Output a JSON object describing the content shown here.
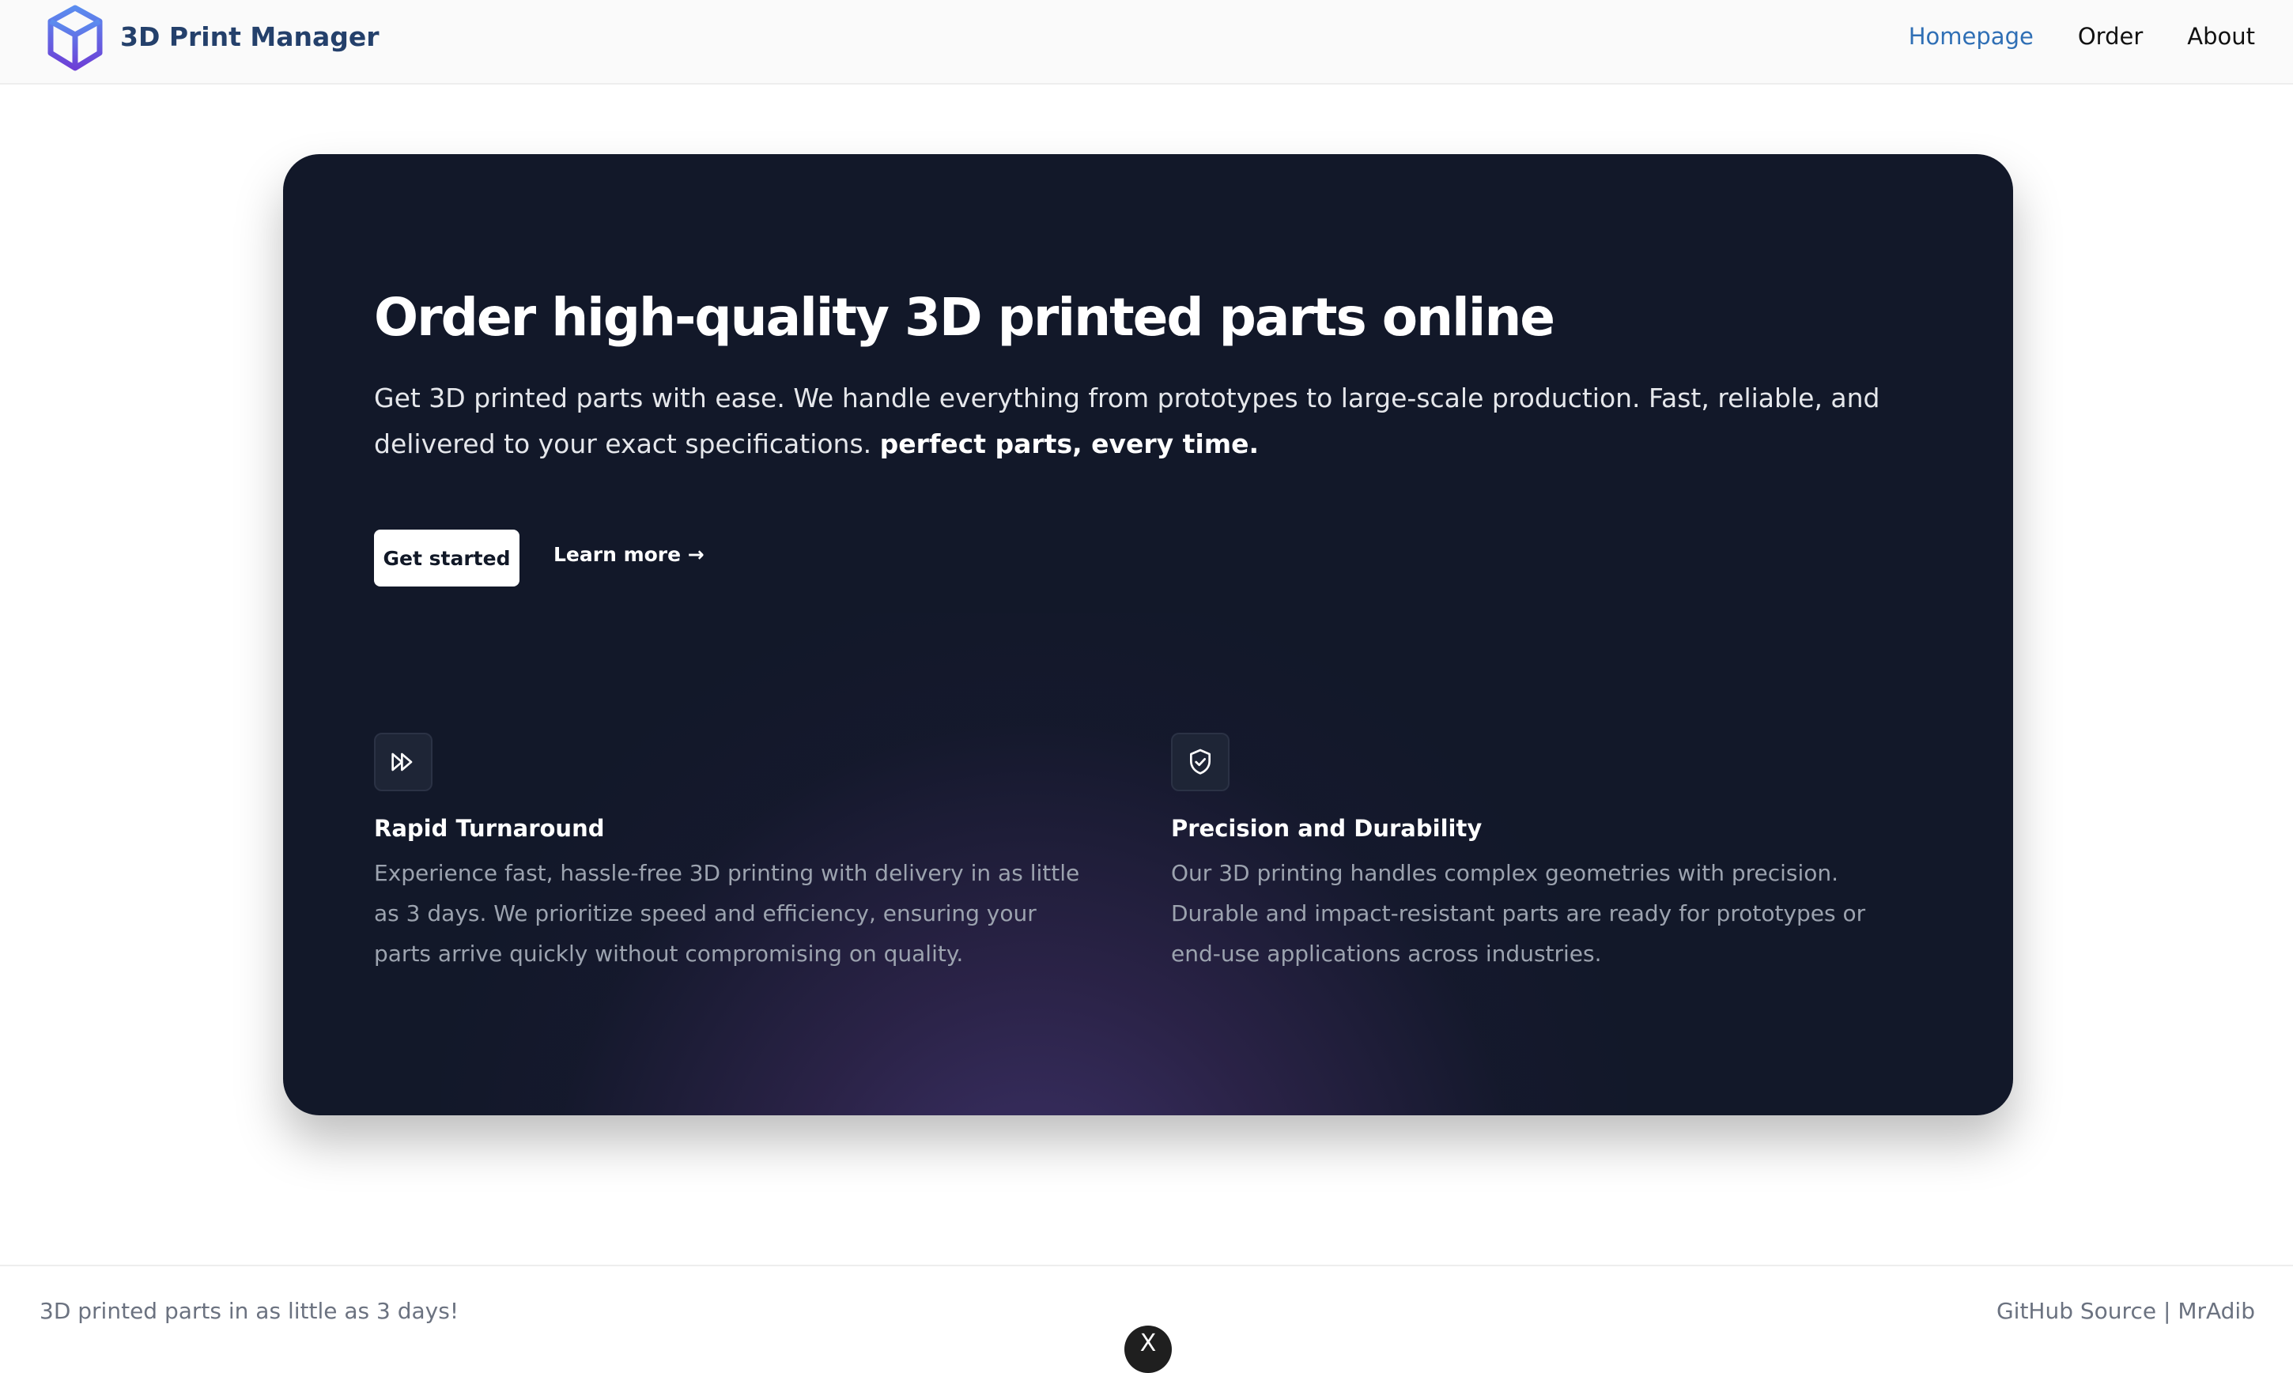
{
  "header": {
    "brand": "3D Print Manager",
    "logo_icon": "cube-icon",
    "nav": [
      {
        "label": "Homepage",
        "active": true
      },
      {
        "label": "Order",
        "active": false
      },
      {
        "label": "About",
        "active": false
      }
    ]
  },
  "hero": {
    "title": "Order high-quality 3D printed parts online",
    "description": "Get 3D printed parts with ease. We handle everything from prototypes to large-scale production. Fast, reliable, and delivered to your exact specifications.",
    "description_emphasis": "perfect parts, every time.",
    "primary_button": "Get started",
    "secondary_link": "Learn more →",
    "features": [
      {
        "icon": "fast-forward-icon",
        "title": "Rapid Turnaround",
        "description": "Experience fast, hassle-free 3D printing with delivery in as little as 3 days. We prioritize speed and efficiency, ensuring your parts arrive quickly without compromising on quality."
      },
      {
        "icon": "shield-check-icon",
        "title": "Precision and Durability",
        "description": "Our 3D printing handles complex geometries with precision. Durable and impact-resistant parts are ready for prototypes or end-use applications across industries."
      }
    ]
  },
  "footer": {
    "tagline": "3D printed parts in as little as 3 days!",
    "source_link": "GitHub Source",
    "separator": "|",
    "author_link": "MrAdib",
    "close_glyph": "X"
  },
  "colors": {
    "brand_text": "#24406b",
    "nav_active": "#2f6fb5",
    "hero_background": "#121829",
    "glow": "#6248a0",
    "logo_light": "#5b8def",
    "logo_dark": "#6d3fd6"
  }
}
